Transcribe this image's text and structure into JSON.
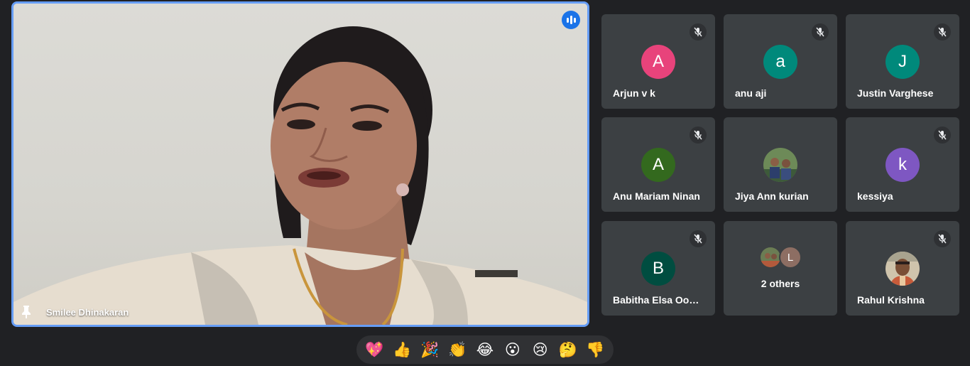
{
  "main_speaker": {
    "name": "Smilee Dhinakaran",
    "pinned": true,
    "speaking": true
  },
  "participants": [
    {
      "name": "Arjun v k",
      "initial": "A",
      "avatar_color": "#e8437b",
      "muted": true
    },
    {
      "name": "anu aji",
      "initial": "a",
      "avatar_color": "#00897b",
      "muted": true
    },
    {
      "name": "Justin Varghese",
      "initial": "J",
      "avatar_color": "#00897b",
      "muted": true
    },
    {
      "name": "Anu Mariam Ninan",
      "initial": "A",
      "avatar_color": "#33691e",
      "muted": true
    },
    {
      "name": "Jiya Ann kurian",
      "initial": "",
      "avatar_color": "#5d7a4c",
      "muted": false
    },
    {
      "name": "kessiya",
      "initial": "k",
      "avatar_color": "#7e57c2",
      "muted": true
    },
    {
      "name": "Babitha Elsa Oom...",
      "initial": "B",
      "avatar_color": "#004d40",
      "muted": true
    },
    {
      "name": "Rahul Krishna",
      "initial": "",
      "avatar_color": "#b8a98c",
      "muted": true
    }
  ],
  "others": {
    "label": "2 others",
    "second_initial": "L"
  },
  "reactions": [
    "💖",
    "👍",
    "🎉",
    "👏",
    "😂",
    "😮",
    "😢",
    "🤔",
    "👎"
  ],
  "colors": {
    "background": "#202124",
    "tile": "#3c4043",
    "active_border": "#669df6",
    "speaking_blue": "#1a73e8"
  }
}
